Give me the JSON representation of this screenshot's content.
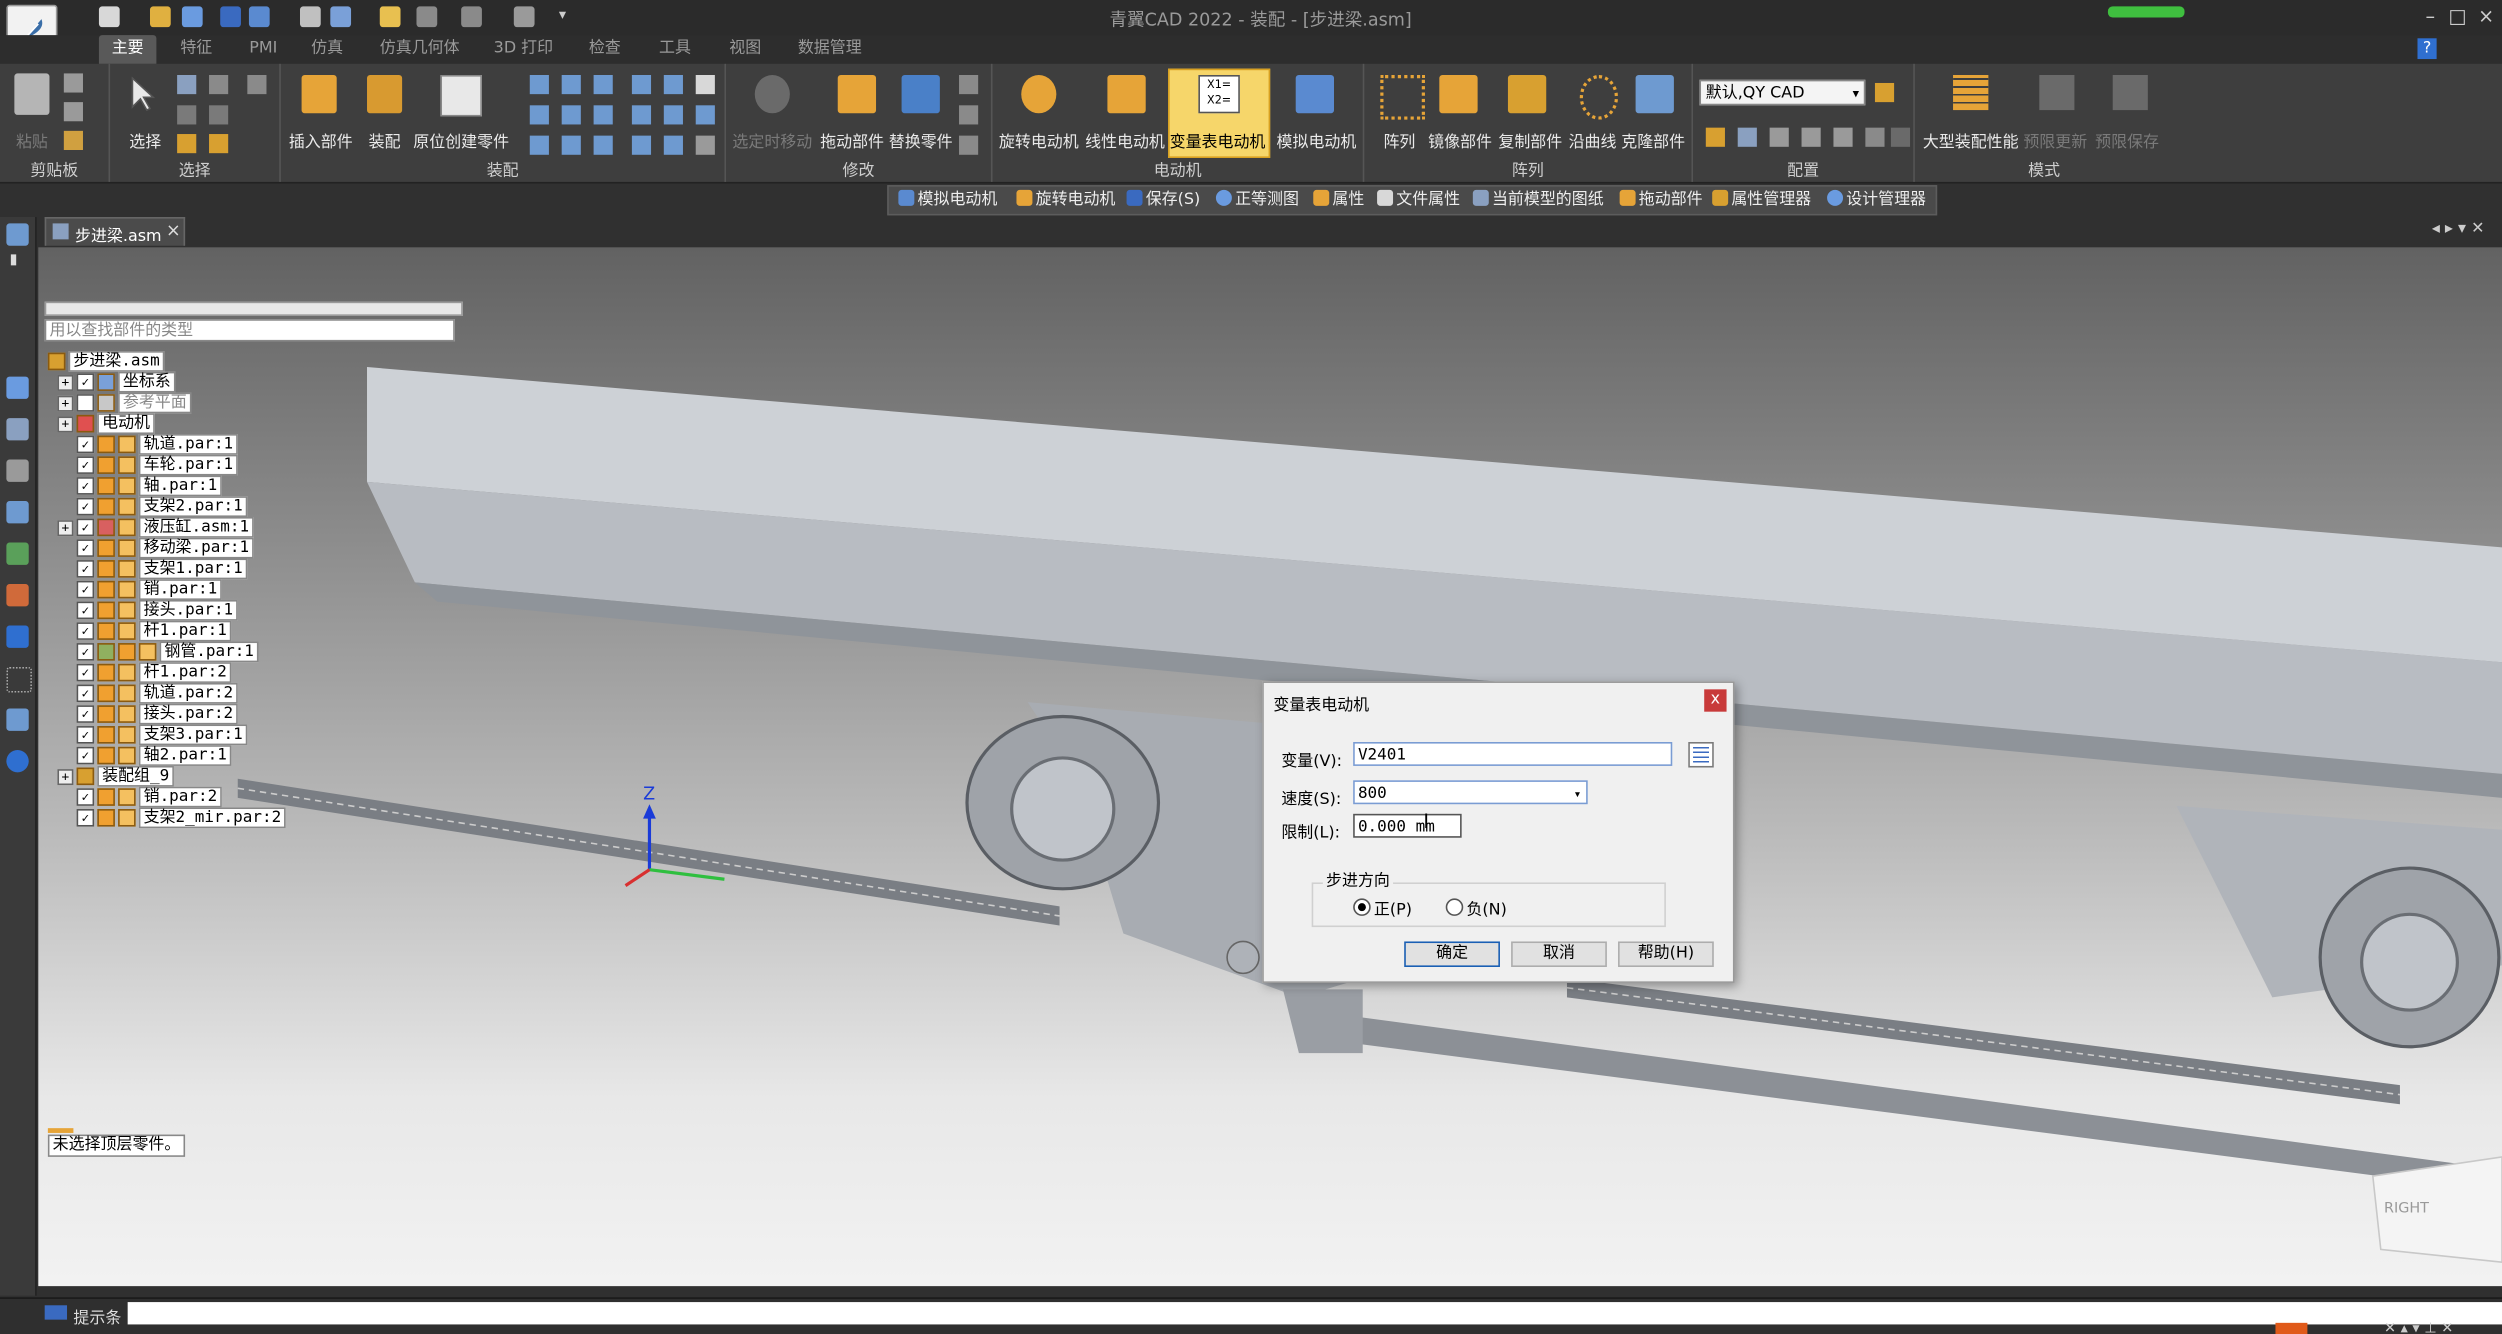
{
  "titlebar": {
    "title": "青翼CAD 2022 - 装配 - [步进梁.asm]",
    "minimize": "–",
    "maximize": "□",
    "close": "×"
  },
  "tabs": [
    "主要",
    "特征",
    "PMI",
    "仿真",
    "仿真几何体",
    "3D 打印",
    "检查",
    "工具",
    "视图",
    "数据管理"
  ],
  "ribbon": {
    "clipboard": {
      "paste": "粘贴",
      "group": "剪贴板"
    },
    "select": {
      "select": "选择",
      "group": "选择"
    },
    "assemble": {
      "insert": "插入部件",
      "assemble": "装配",
      "in_place": "原位创建零件",
      "group": "装配"
    },
    "modify": {
      "selected_move": "选定时移动",
      "drag": "拖动部件",
      "replace": "替换零件",
      "group": "修改"
    },
    "motor": {
      "rotary": "旋转电动机",
      "linear": "线性电动机",
      "variable": "变量表电动机",
      "simulate": "模拟电动机",
      "group": "电动机"
    },
    "pattern": {
      "array": "阵列",
      "mirror": "镜像部件",
      "copy": "复制部件",
      "along_curve": "沿曲线",
      "clone": "克隆部件",
      "group": "阵列"
    },
    "config": {
      "dropdown": "默认,QY CAD",
      "group": "配置"
    },
    "mode": {
      "large": "大型装配性能",
      "limited_update": "预限更新",
      "limited_save": "预限保存",
      "group": "模式"
    }
  },
  "command_bar": [
    "模拟电动机",
    "旋转电动机",
    "保存(S)",
    "正等测图",
    "属性",
    "文件属性",
    "当前模型的图纸",
    "拖动部件",
    "属性管理器",
    "设计管理器"
  ],
  "doc_tab": {
    "label": "步进梁.asm",
    "close": "×"
  },
  "tree": {
    "search_placeholder": "用以查找部件的类型",
    "items": [
      {
        "label": "步进梁.asm"
      },
      {
        "label": "坐标系"
      },
      {
        "label": "参考平面"
      },
      {
        "label": "电动机"
      },
      {
        "label": "轨道.par:1"
      },
      {
        "label": "车轮.par:1"
      },
      {
        "label": "轴.par:1"
      },
      {
        "label": "支架2.par:1"
      },
      {
        "label": "液压缸.asm:1"
      },
      {
        "label": "移动梁.par:1"
      },
      {
        "label": "支架1.par:1"
      },
      {
        "label": "销.par:1"
      },
      {
        "label": "接头.par:1"
      },
      {
        "label": "杆1.par:1"
      },
      {
        "label": "钢管.par:1"
      },
      {
        "label": "杆1.par:2"
      },
      {
        "label": "轨道.par:2"
      },
      {
        "label": "接头.par:2"
      },
      {
        "label": "支架3.par:1"
      },
      {
        "label": "轴2.par:1"
      },
      {
        "label": "装配组_9"
      },
      {
        "label": "销.par:2"
      },
      {
        "label": "支架2_mir.par:2"
      }
    ],
    "status": "未选择顶层零件。"
  },
  "viewport": {
    "axis_z": "Z",
    "view_cube": "RIGHT"
  },
  "dialog": {
    "title": "变量表电动机",
    "close": "x",
    "variable_label": "变量(V):",
    "variable_value": "V2401",
    "speed_label": "速度(S):",
    "speed_value": "800",
    "limit_label": "限制(L):",
    "limit_value": "0.000 mm",
    "direction_group": "步进方向",
    "positive": "正(P)",
    "negative": "负(N)",
    "selected_direction": "正(P)",
    "ok": "确定",
    "cancel": "取消",
    "help": "帮助(H)"
  },
  "commandline": {
    "label": "提示条"
  },
  "colors": {
    "ribbon_bg": "#3e3e3e",
    "highlight": "#f6d66a",
    "dialog_bg": "#f0f0f0",
    "beam": "#c9cdd2"
  }
}
